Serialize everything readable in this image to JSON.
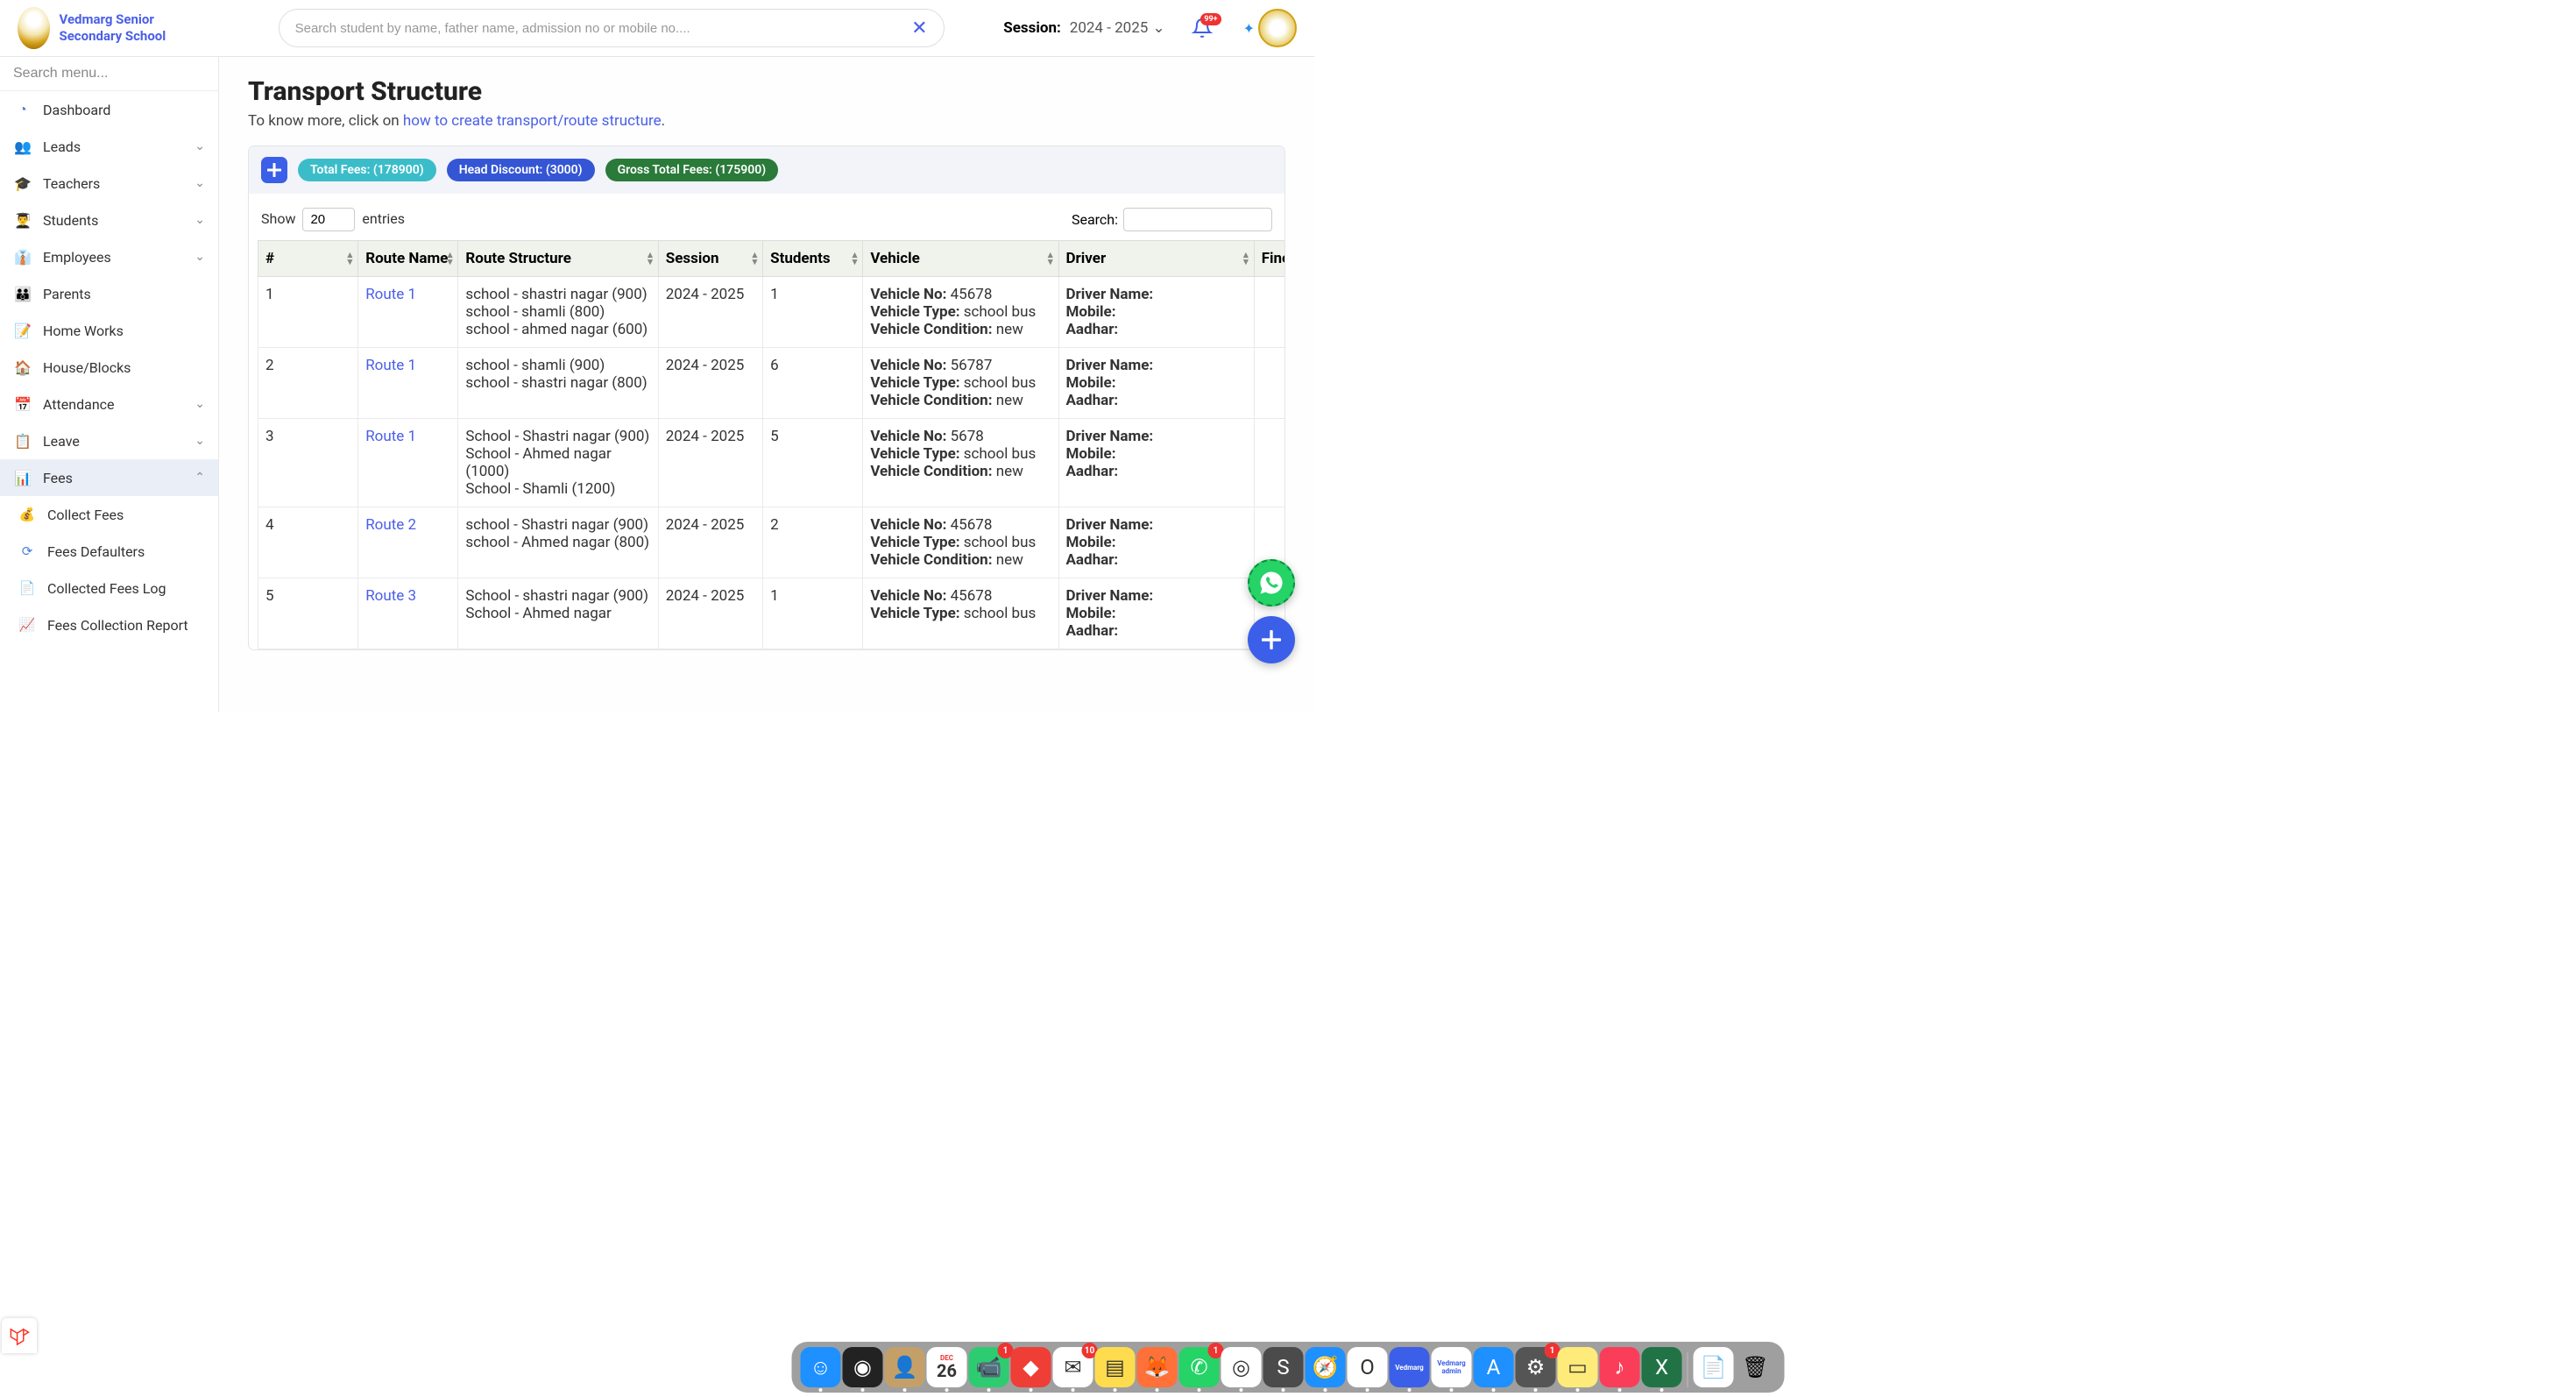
{
  "header": {
    "school_name": "Vedmarg Senior Secondary School",
    "search_placeholder": "Search student by name, father name, admission no or mobile no....",
    "session_label": "Session:",
    "session_value": "2024 - 2025",
    "notif_badge": "99+"
  },
  "sidebar": {
    "search_placeholder": "Search menu...",
    "items": [
      {
        "icon": "dashboard-icon",
        "glyph": "◔",
        "label": "Dashboard",
        "expandable": false
      },
      {
        "icon": "leads-icon",
        "glyph": "👥",
        "label": "Leads",
        "expandable": true
      },
      {
        "icon": "teachers-icon",
        "glyph": "🎓",
        "label": "Teachers",
        "expandable": true
      },
      {
        "icon": "students-icon",
        "glyph": "👨‍🎓",
        "label": "Students",
        "expandable": true
      },
      {
        "icon": "employees-icon",
        "glyph": "👔",
        "label": "Employees",
        "expandable": true
      },
      {
        "icon": "parents-icon",
        "glyph": "👪",
        "label": "Parents",
        "expandable": false
      },
      {
        "icon": "homeworks-icon",
        "glyph": "📝",
        "label": "Home Works",
        "expandable": false
      },
      {
        "icon": "house-icon",
        "glyph": "🏠",
        "label": "House/Blocks",
        "expandable": false
      },
      {
        "icon": "attendance-icon",
        "glyph": "📅",
        "label": "Attendance",
        "expandable": true
      },
      {
        "icon": "leave-icon",
        "glyph": "📋",
        "label": "Leave",
        "expandable": true
      },
      {
        "icon": "fees-icon",
        "glyph": "📊",
        "label": "Fees",
        "expandable": true,
        "active": true,
        "open": true
      }
    ],
    "fees_sub": [
      {
        "icon": "collect-icon",
        "glyph": "💰",
        "label": "Collect Fees"
      },
      {
        "icon": "defaulters-icon",
        "glyph": "⟳",
        "label": "Fees Defaulters"
      },
      {
        "icon": "log-icon",
        "glyph": "📄",
        "label": "Collected Fees Log"
      },
      {
        "icon": "report-icon",
        "glyph": "📈",
        "label": "Fees Collection Report"
      }
    ]
  },
  "page": {
    "title": "Transport Structure",
    "sub_prefix": "To know more, click on ",
    "sub_link": "how to create transport/route structure",
    "sub_suffix": "."
  },
  "pills": {
    "total": "Total Fees: (178900)",
    "discount": "Head Discount: (3000)",
    "gross": "Gross Total Fees: (175900)"
  },
  "table": {
    "show_label_pre": "Show",
    "show_value": "20",
    "show_label_post": "entries",
    "search_label": "Search:",
    "columns": [
      "#",
      "Route Name",
      "Route Structure",
      "Session",
      "Students",
      "Vehicle",
      "Driver",
      "Fine"
    ],
    "vehicle_labels": {
      "no": "Vehicle No:",
      "type": "Vehicle Type:",
      "cond": "Vehicle Condition:"
    },
    "driver_labels": {
      "name": "Driver Name:",
      "mobile": "Mobile:",
      "aadhar": "Aadhar:"
    },
    "rows": [
      {
        "n": "1",
        "route": "Route 1",
        "structure": "school - shastri nagar (900)\nschool - shamli (800)\nschool - ahmed nagar (600)",
        "session": "2024 - 2025",
        "students": "1",
        "v_no": "45678",
        "v_type": "school bus",
        "v_cond": "new",
        "d_name": "",
        "d_mob": "",
        "d_aad": ""
      },
      {
        "n": "2",
        "route": "Route 1",
        "structure": "school - shamli (900)\nschool - shastri nagar (800)",
        "session": "2024 - 2025",
        "students": "6",
        "v_no": "56787",
        "v_type": "school bus",
        "v_cond": "new",
        "d_name": "",
        "d_mob": "",
        "d_aad": ""
      },
      {
        "n": "3",
        "route": "Route 1",
        "structure": "School - Shastri nagar (900)\nSchool - Ahmed nagar (1000)\nSchool - Shamli (1200)",
        "session": "2024 - 2025",
        "students": "5",
        "v_no": "5678",
        "v_type": "school bus",
        "v_cond": "new",
        "d_name": "",
        "d_mob": "",
        "d_aad": ""
      },
      {
        "n": "4",
        "route": "Route 2",
        "structure": "school - Shastri nagar (900)\nschool - Ahmed nagar (800)",
        "session": "2024 - 2025",
        "students": "2",
        "v_no": "45678",
        "v_type": "school bus",
        "v_cond": "new",
        "d_name": "",
        "d_mob": "",
        "d_aad": ""
      },
      {
        "n": "5",
        "route": "Route 3",
        "structure": "School - shastri nagar (900)\nSchool - Ahmed nagar",
        "session": "2024 - 2025",
        "students": "1",
        "v_no": "45678",
        "v_type": "school bus",
        "v_cond": "",
        "d_name": "",
        "d_mob": "",
        "d_aad": ""
      }
    ]
  },
  "dock": [
    {
      "name": "finder",
      "bg": "#1e90ff",
      "glyph": "☺",
      "badge": ""
    },
    {
      "name": "siri",
      "bg": "#222",
      "glyph": "◉",
      "badge": ""
    },
    {
      "name": "contacts",
      "bg": "#c4a068",
      "glyph": "👤",
      "badge": ""
    },
    {
      "name": "calendar",
      "bg": "#fff",
      "glyph": "",
      "badge": "",
      "cal": {
        "month": "DEC",
        "day": "26"
      }
    },
    {
      "name": "facetime",
      "bg": "#2ecc71",
      "glyph": "📹",
      "badge": "1"
    },
    {
      "name": "anydesk",
      "bg": "#ef3e36",
      "glyph": "◆",
      "badge": ""
    },
    {
      "name": "mail",
      "bg": "#fff",
      "glyph": "✉",
      "badge": "10"
    },
    {
      "name": "notes",
      "bg": "#ffdc4e",
      "glyph": "▤",
      "badge": ""
    },
    {
      "name": "firefox",
      "bg": "#ff7139",
      "glyph": "🦊",
      "badge": ""
    },
    {
      "name": "whatsapp",
      "bg": "#25d366",
      "glyph": "✆",
      "badge": "1"
    },
    {
      "name": "chrome",
      "bg": "#fff",
      "glyph": "◎",
      "badge": ""
    },
    {
      "name": "sublime",
      "bg": "#4b4b4b",
      "glyph": "S",
      "badge": ""
    },
    {
      "name": "safari",
      "bg": "#1e90ff",
      "glyph": "🧭",
      "badge": ""
    },
    {
      "name": "opera",
      "bg": "#fff",
      "glyph": "O",
      "badge": ""
    },
    {
      "name": "vedmarg1",
      "bg": "#3b5fe8",
      "glyph": "Vedmarg",
      "badge": "",
      "txt": true
    },
    {
      "name": "vedmarg2",
      "bg": "#fff",
      "glyph": "Vedmarg\nadmin",
      "badge": "",
      "txt": true
    },
    {
      "name": "appstore",
      "bg": "#1e90ff",
      "glyph": "A",
      "badge": ""
    },
    {
      "name": "settings",
      "bg": "#555",
      "glyph": "⚙",
      "badge": "1"
    },
    {
      "name": "stickies",
      "bg": "#ffeb7a",
      "glyph": "▭",
      "badge": ""
    },
    {
      "name": "music",
      "bg": "#fa3e5a",
      "glyph": "♪",
      "badge": ""
    },
    {
      "name": "excel",
      "bg": "#217346",
      "glyph": "X",
      "badge": ""
    }
  ],
  "dock_right": [
    {
      "name": "doc",
      "bg": "#fff",
      "glyph": "📄"
    },
    {
      "name": "trash",
      "bg": "transparent",
      "glyph": "🗑"
    }
  ]
}
